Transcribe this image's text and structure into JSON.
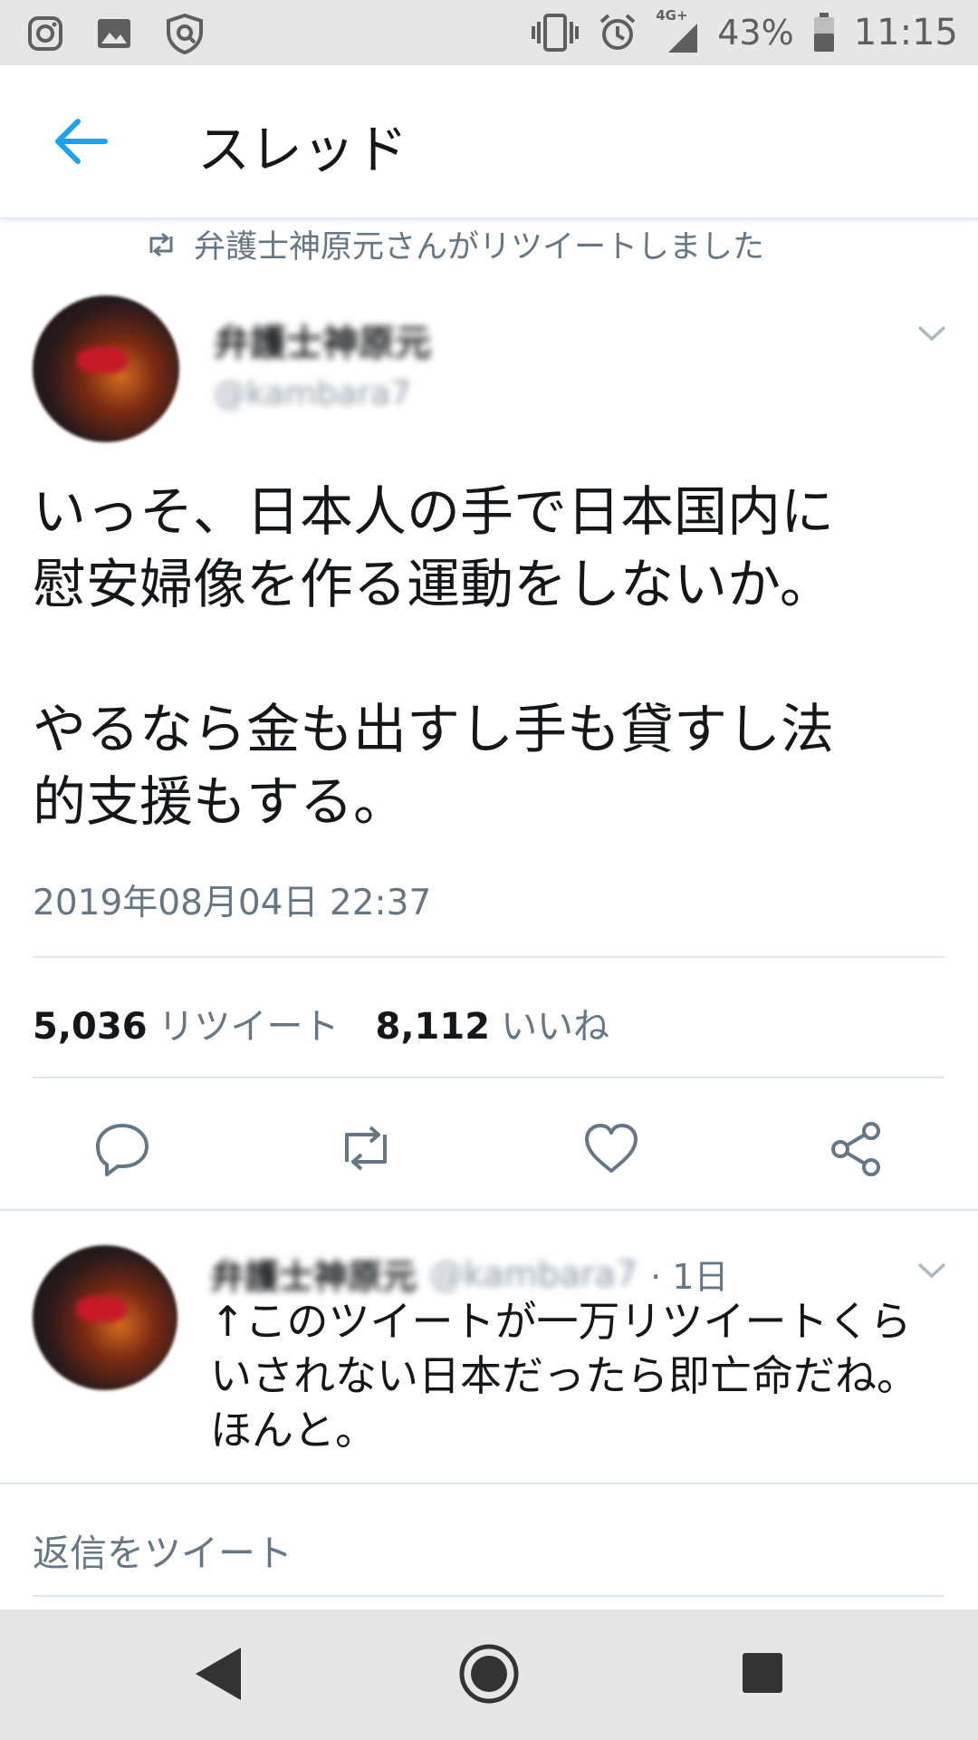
{
  "status_bar": {
    "battery": "43%",
    "time": "11:15",
    "network": "4G+",
    "left_icons": [
      "instagram-icon",
      "gallery-icon",
      "shield-icon"
    ],
    "right_icons": [
      "vibrate-icon",
      "alarm-icon",
      "signal-icon",
      "battery-icon"
    ]
  },
  "header": {
    "title": "スレッド",
    "back_icon": "arrow-left-icon",
    "accent_color": "#1da1f2"
  },
  "retweet_indicator": {
    "text": "弁護士神原元さんがリツイートしました"
  },
  "tweet": {
    "display_name": "弁護士神原元",
    "handle": "@kambara7",
    "text": "いっそ、日本人の手で日本国内に\n慰安婦像を作る運動をしないか。\n\nやるなら金も出すし手も貸すし法\n的支援もする。",
    "timestamp": "2019年08月04日 22:37",
    "retweets": "5,036",
    "retweets_label": "リツイート",
    "likes": "8,112",
    "likes_label": "いいね",
    "actions": [
      "reply-icon",
      "retweet-icon",
      "like-icon",
      "share-icon"
    ]
  },
  "reply": {
    "display_name": "弁護士神原元",
    "handle": "@kambara7",
    "time": "· 1日",
    "text": "↑このツイートが一万リツイートくらいされない日本だったら即亡命だね。ほんと。"
  },
  "compose": {
    "placeholder": "返信をツイート"
  },
  "nav_bar": {
    "buttons": [
      "back-triangle-icon",
      "home-circle-icon",
      "recents-square-icon"
    ]
  }
}
